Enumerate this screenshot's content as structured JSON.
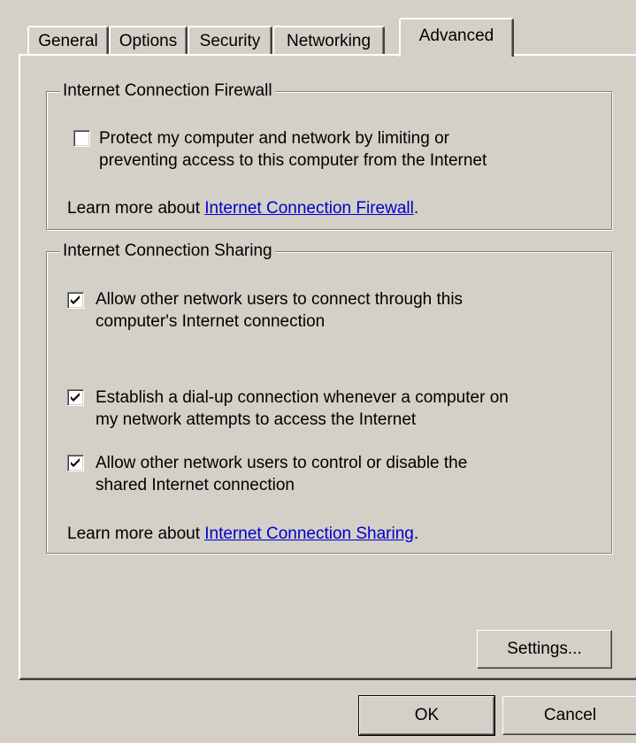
{
  "tabs": [
    {
      "label": "General",
      "active": false
    },
    {
      "label": "Options",
      "active": false
    },
    {
      "label": "Security",
      "active": false
    },
    {
      "label": "Networking",
      "active": false
    },
    {
      "label": "Advanced",
      "active": true
    }
  ],
  "firewall": {
    "legend": "Internet Connection Firewall",
    "protect": {
      "checked": false,
      "line1": "Protect my computer and network by limiting or",
      "line2": "preventing access to this computer from the Internet"
    },
    "learn_prefix": "Learn more about ",
    "learn_link": "Internet Connection Firewall",
    "learn_suffix": "."
  },
  "sharing": {
    "legend": "Internet Connection Sharing",
    "options": [
      {
        "checked": true,
        "line1": "Allow other network users to connect through this",
        "line2": "computer's Internet connection"
      },
      {
        "checked": true,
        "line1": "Establish a dial-up connection whenever a computer on",
        "line2": "my network attempts to access the Internet"
      },
      {
        "checked": true,
        "line1": "Allow other network users to control or disable the",
        "line2": "shared Internet connection"
      }
    ],
    "learn_prefix": "Learn more about ",
    "learn_link": "Internet Connection Sharing",
    "learn_suffix": "."
  },
  "buttons": {
    "settings": "Settings...",
    "ok": "OK",
    "cancel": "Cancel"
  }
}
